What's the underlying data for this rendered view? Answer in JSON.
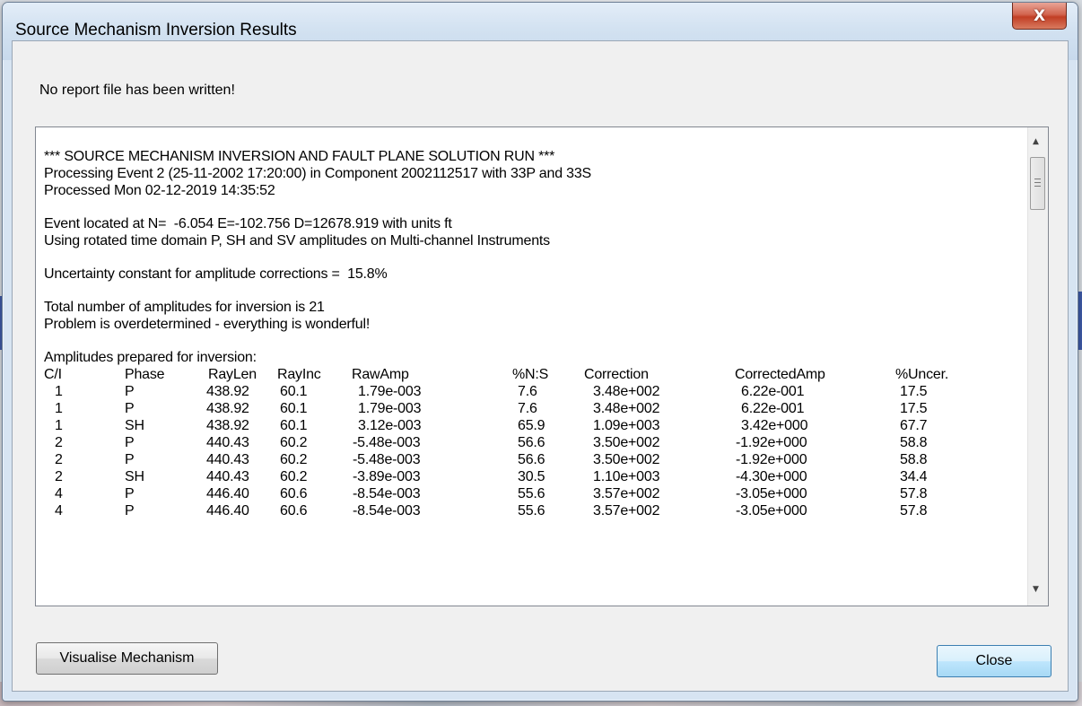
{
  "window": {
    "title": "Source Mechanism Inversion Results",
    "close_glyph": "X"
  },
  "message": "No report file has been written!",
  "report": {
    "lines_top": [
      "*** SOURCE MECHANISM INVERSION AND FAULT PLANE SOLUTION RUN ***",
      "Processing Event 2 (25-11-2002 17:20:00) in Component 2002112517 with 33P and 33S",
      "Processed Mon 02-12-2019 14:35:52",
      "",
      "Event located at N=  -6.054 E=-102.756 D=12678.919 with units ft",
      "Using rotated time domain P, SH and SV amplitudes on Multi-channel Instruments",
      "",
      "Uncertainty constant for amplitude corrections =  15.8%",
      "",
      "Total number of amplitudes for inversion is 21",
      "Problem is overdetermined - everything is wonderful!",
      "",
      "Amplitudes prepared for inversion:"
    ],
    "table_headers": [
      "C/I",
      "Phase",
      "RayLen",
      "RayInc",
      "RawAmp",
      "%N:S",
      "Correction",
      "CorrectedAmp",
      "%Uncer."
    ],
    "table_rows": [
      [
        "1",
        "P",
        "438.92",
        "60.1",
        "1.79e-003",
        "7.6",
        "3.48e+002",
        "6.22e-001",
        "17.5"
      ],
      [
        "1",
        "P",
        "438.92",
        "60.1",
        "1.79e-003",
        "7.6",
        "3.48e+002",
        "6.22e-001",
        "17.5"
      ],
      [
        "1",
        "SH",
        "438.92",
        "60.1",
        "3.12e-003",
        "65.9",
        "1.09e+003",
        "3.42e+000",
        "67.7"
      ],
      [
        "2",
        "P",
        "440.43",
        "60.2",
        "-5.48e-003",
        "56.6",
        "3.50e+002",
        "-1.92e+000",
        "58.8"
      ],
      [
        "2",
        "P",
        "440.43",
        "60.2",
        "-5.48e-003",
        "56.6",
        "3.50e+002",
        "-1.92e+000",
        "58.8"
      ],
      [
        "2",
        "SH",
        "440.43",
        "60.2",
        "-3.89e-003",
        "30.5",
        "1.10e+003",
        "-4.30e+000",
        "34.4"
      ],
      [
        "4",
        "P",
        "446.40",
        "60.6",
        "-8.54e-003",
        "55.6",
        "3.57e+002",
        "-3.05e+000",
        "57.8"
      ],
      [
        "4",
        "P",
        "446.40",
        "60.6",
        "-8.54e-003",
        "55.6",
        "3.57e+002",
        "-3.05e+000",
        "57.8"
      ]
    ]
  },
  "buttons": {
    "visualise": "Visualise Mechanism",
    "close": "Close"
  },
  "icons": {
    "scroll_up": "scroll-up-arrow-icon",
    "scroll_down": "scroll-down-arrow-icon",
    "close": "close-icon"
  }
}
